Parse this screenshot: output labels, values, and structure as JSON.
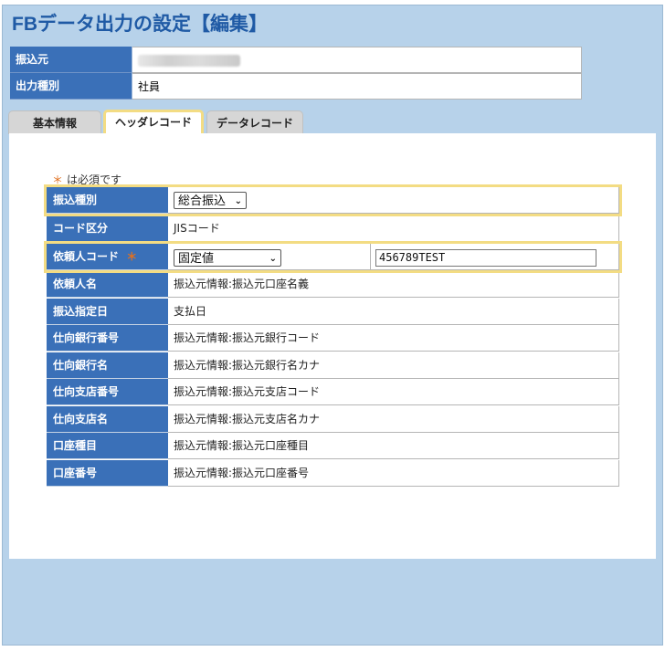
{
  "title": "FBデータ出力の設定【編集】",
  "info": {
    "source_label": "振込元",
    "output_type_label": "出力種別",
    "output_type_value": "社員"
  },
  "tabs": [
    {
      "label": "基本情報",
      "active": false
    },
    {
      "label": "ヘッダレコード",
      "active": true
    },
    {
      "label": "データレコード",
      "active": false
    }
  ],
  "required_note": {
    "mark": "＊",
    "text": "は必須です"
  },
  "form": {
    "transfer_type": {
      "label": "振込種別",
      "value": "総合振込"
    },
    "code_class": {
      "label": "コード区分",
      "value": "JISコード"
    },
    "requester_code": {
      "label": "依頼人コード",
      "mark": "＊",
      "select_value": "固定値",
      "input_value": "456789TEST"
    },
    "rows": [
      {
        "label": "依頼人名",
        "value": "振込元情報:振込元口座名義"
      },
      {
        "label": "振込指定日",
        "value": "支払日"
      },
      {
        "label": "仕向銀行番号",
        "value": "振込元情報:振込元銀行コード"
      },
      {
        "label": "仕向銀行名",
        "value": "振込元情報:振込元銀行名カナ"
      },
      {
        "label": "仕向支店番号",
        "value": "振込元情報:振込元支店コード"
      },
      {
        "label": "仕向支店名",
        "value": "振込元情報:振込元支店名カナ"
      },
      {
        "label": "口座種目",
        "value": "振込元情報:振込元口座種目"
      },
      {
        "label": "口座番号",
        "value": "振込元情報:振込元口座番号"
      }
    ]
  },
  "colors": {
    "background": "#b7d2ea",
    "label_bg": "#3a70b8",
    "title": "#1f5aa5",
    "highlight": "#f3dc83",
    "required": "#e07020"
  }
}
